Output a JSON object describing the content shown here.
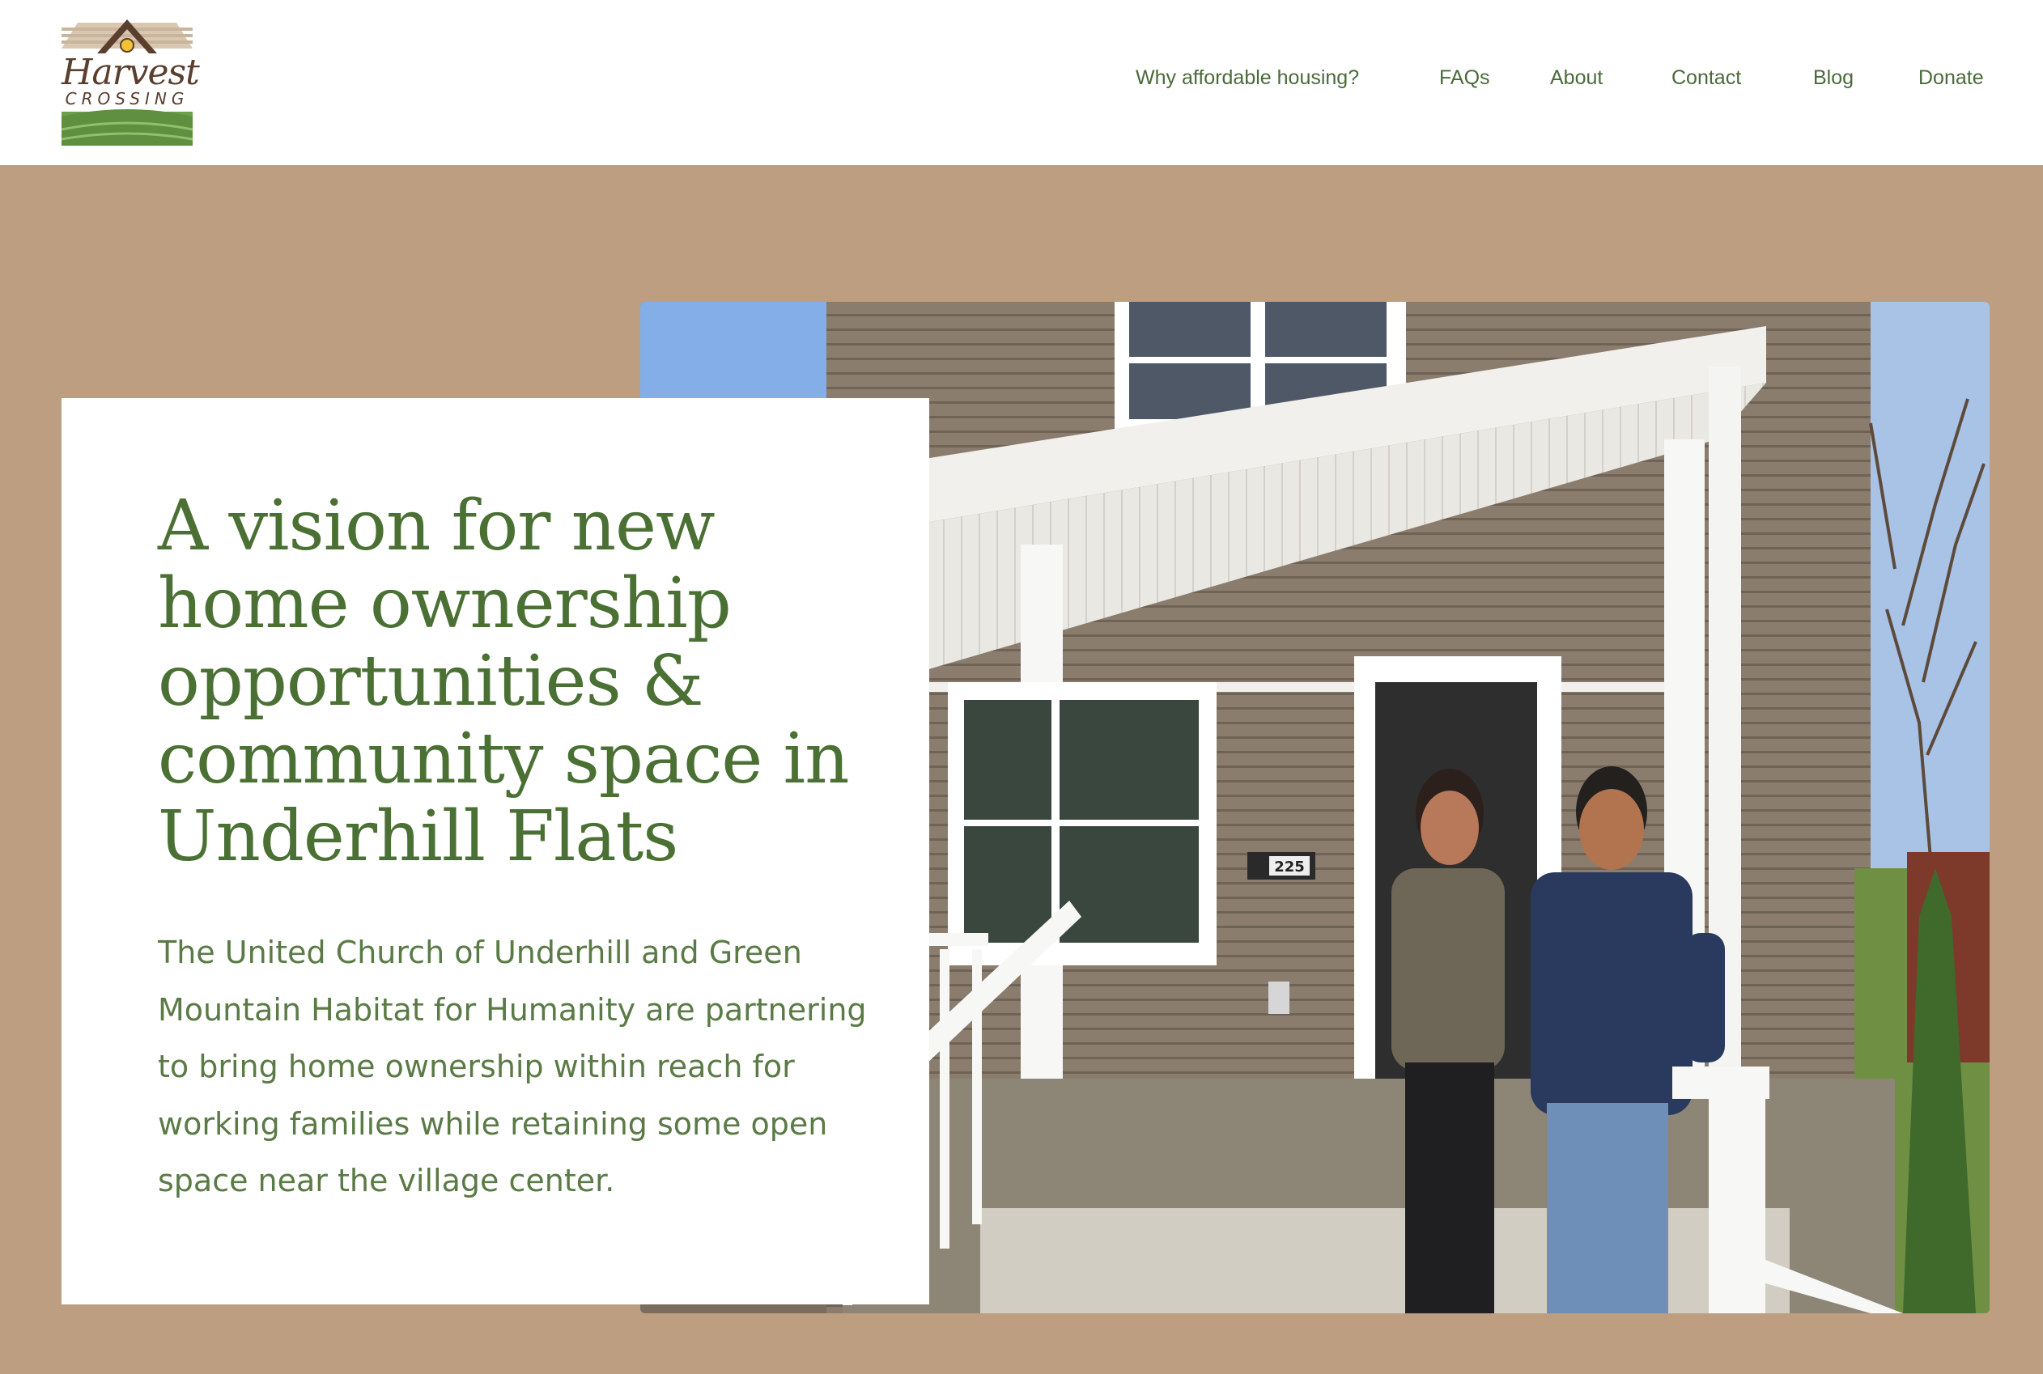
{
  "logo": {
    "line1": "Harvest",
    "line2": "CROSSING",
    "colors": {
      "roof": "#5a3e2e",
      "sun": "#f2c232",
      "field": "#6aa04a",
      "sky": "#d9c7b2"
    }
  },
  "nav": {
    "items": [
      {
        "label": "Why affordable housing?"
      },
      {
        "label": "FAQs"
      },
      {
        "label": "About"
      },
      {
        "label": "Contact"
      },
      {
        "label": "Blog"
      },
      {
        "label": "Donate"
      }
    ]
  },
  "hero": {
    "title": "A vision for new home ownership opportunities & community space in Underhill Flats",
    "body": "The United Church of Underhill and Green Mountain Habitat for Humanity are partnering to bring home ownership within reach for working families while retaining some open space near the village center.",
    "photo": {
      "house_number": "225"
    }
  },
  "colors": {
    "page_bg": "#bd9e80",
    "heading": "#4a7034",
    "body_text": "#5a7a46",
    "nav_text": "#4a6a3a"
  }
}
